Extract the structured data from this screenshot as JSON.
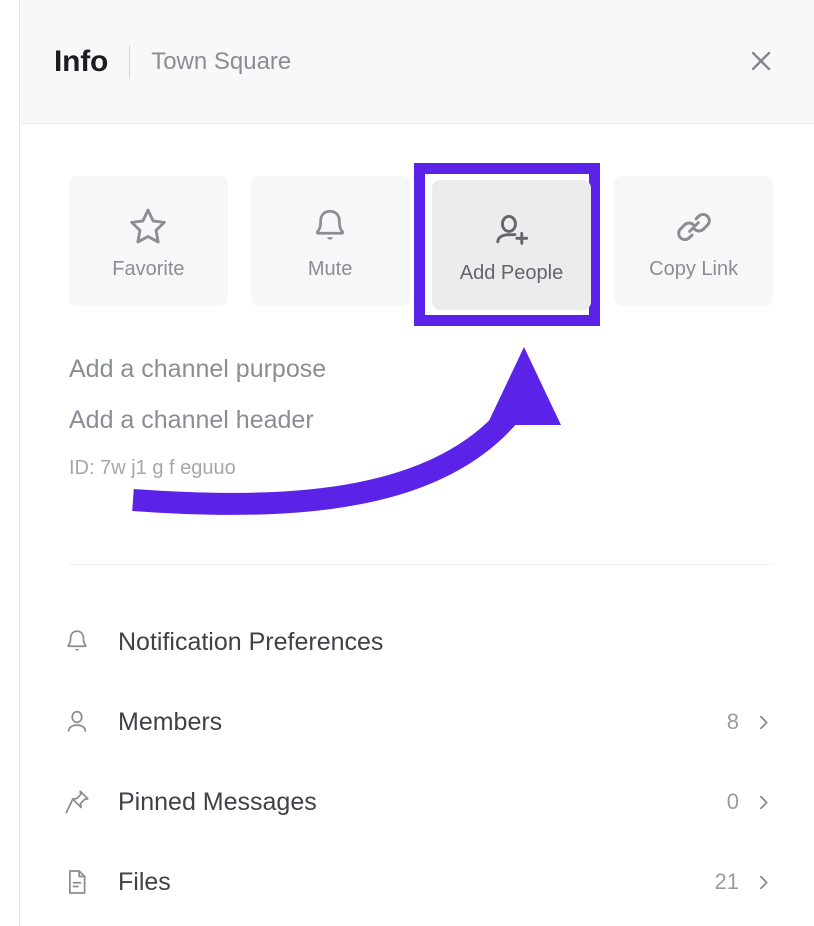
{
  "header": {
    "title": "Info",
    "subtitle": "Town Square",
    "close_icon": "close-icon"
  },
  "actions": [
    {
      "label": "Favorite",
      "icon": "star-icon",
      "highlighted": false
    },
    {
      "label": "Mute",
      "icon": "bell-icon",
      "highlighted": false
    },
    {
      "label": "Add People",
      "icon": "add-person-icon",
      "highlighted": true
    },
    {
      "label": "Copy Link",
      "icon": "link-icon",
      "highlighted": false
    }
  ],
  "meta": {
    "purpose_placeholder": "Add a channel purpose",
    "header_placeholder": "Add a channel header",
    "channel_id": "ID: 7w          j1 g     f         eguuo"
  },
  "list": [
    {
      "label": "Notification Preferences",
      "icon": "bell-icon",
      "count": "",
      "chevron": false
    },
    {
      "label": "Members",
      "icon": "person-icon",
      "count": "8",
      "chevron": true
    },
    {
      "label": "Pinned Messages",
      "icon": "pin-icon",
      "count": "0",
      "chevron": true
    },
    {
      "label": "Files",
      "icon": "document-icon",
      "count": "21",
      "chevron": true
    }
  ],
  "annotation": {
    "highlight_color": "#5b22e8",
    "arrow_color": "#5b22e8",
    "target": "Add People"
  }
}
